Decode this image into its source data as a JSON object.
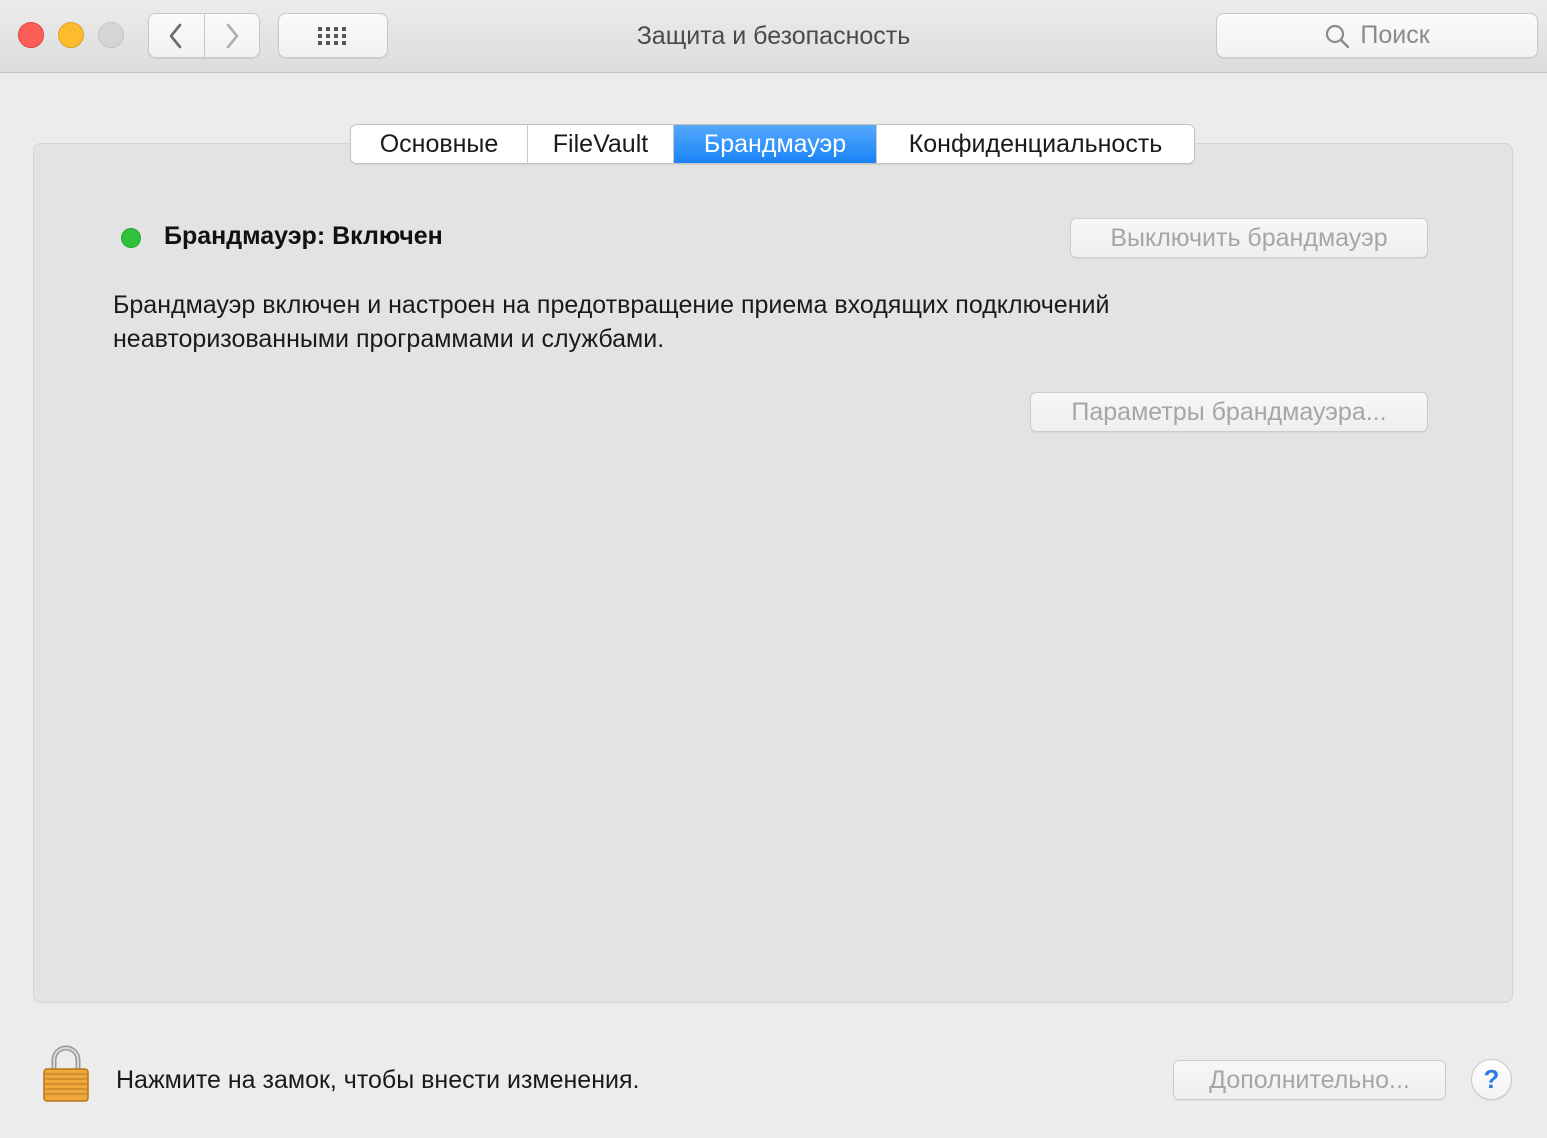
{
  "window": {
    "title": "Защита и безопасность"
  },
  "toolbar": {
    "back_icon": "chevron-left-icon",
    "forward_icon": "chevron-right-icon",
    "grid_icon": "grid-icon",
    "search_placeholder": "Поиск"
  },
  "tabs": [
    {
      "label": "Основные",
      "active": false
    },
    {
      "label": "FileVault",
      "active": false
    },
    {
      "label": "Брандмауэр",
      "active": true
    },
    {
      "label": "Конфиденциальность",
      "active": false
    }
  ],
  "firewall": {
    "status": "Брандмауэр: Включен",
    "status_color": "#2fc13c",
    "turn_off_label": "Выключить брандмауэр",
    "description": "Брандмауэр включен и настроен на предотвращение приема входящих подключений неавторизованными программами и службами.",
    "options_label": "Параметры брандмауэра..."
  },
  "footer": {
    "lock_text": "Нажмите на замок, чтобы внести изменения.",
    "advanced_label": "Дополнительно...",
    "help_label": "?"
  },
  "colors": {
    "accent": "#1a82f7",
    "close": "#fc5f57",
    "minimize": "#fdbc2e"
  }
}
